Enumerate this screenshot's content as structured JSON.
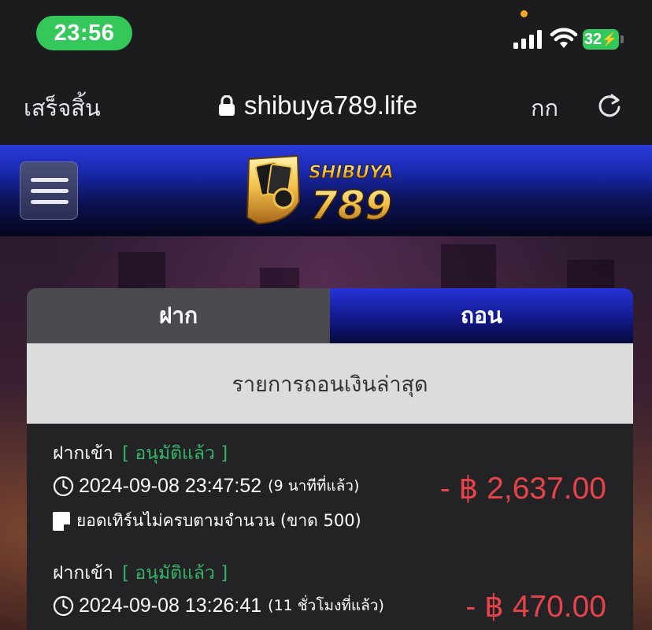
{
  "status_bar": {
    "time": "23:56",
    "battery": "32"
  },
  "browser": {
    "done_label": "เสร็จสิ้น",
    "url": "shibuya789.life",
    "text_size_label": "กก"
  },
  "site": {
    "logo_text_top": "SHIBUYA",
    "logo_text_bottom": "789"
  },
  "tabs": [
    {
      "label": "ฝาก",
      "active": false
    },
    {
      "label": "ถอน",
      "active": true
    }
  ],
  "section_title": "รายการถอนเงินล่าสุด",
  "transactions": [
    {
      "type": "ฝากเข้า",
      "status": "[ อนุมัติแล้ว ]",
      "datetime": "2024-09-08 23:47:52",
      "relative": "(9 นาทีที่แล้ว)",
      "note": "ยอดเทิร์นไม่ครบตามจำนวน (ขาด 500)",
      "amount": "- ฿ 2,637.00"
    },
    {
      "type": "ฝากเข้า",
      "status": "[ อนุมัติแล้ว ]",
      "datetime": "2024-09-08 13:26:41",
      "relative": "(11 ชั่วโมงที่แล้ว)",
      "amount": "- ฿ 470.00"
    }
  ],
  "colors": {
    "status_approved": "#36b36a",
    "amount_negative": "#e8434a",
    "header_blue": "#1a2ab0"
  }
}
